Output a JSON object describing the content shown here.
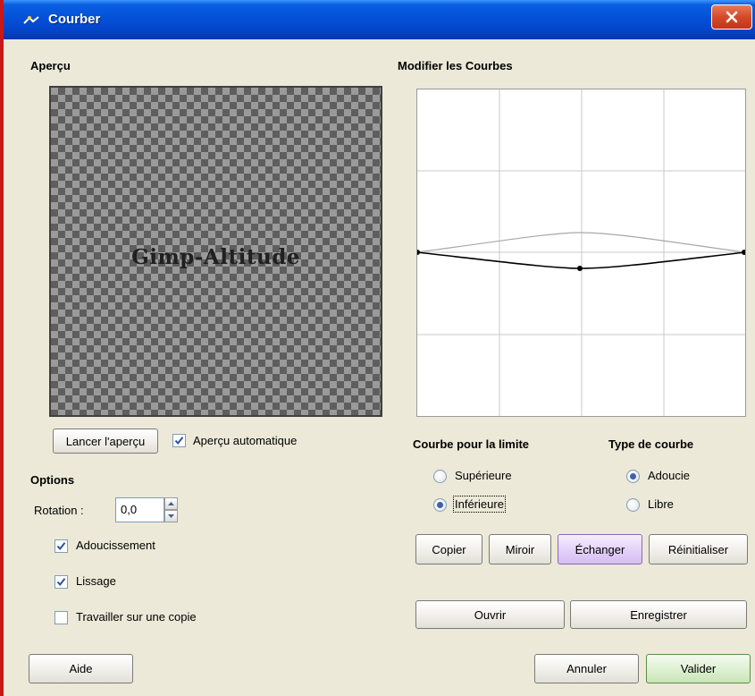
{
  "window": {
    "title": "Courber",
    "icon": "curve-tool-icon",
    "close_icon": "close-icon"
  },
  "preview": {
    "title": "Aperçu",
    "text": "Gimp-Altitude",
    "launch_button": "Lancer l'aperçu",
    "auto_preview_label": "Aperçu automatique",
    "auto_preview_checked": true
  },
  "options": {
    "title": "Options",
    "rotation_label": "Rotation :",
    "rotation_value": "0,0",
    "antialiasing_label": "Adoucissement",
    "antialiasing_checked": true,
    "smoothing_label": "Lissage",
    "smoothing_checked": true,
    "work_on_copy_label": "Travailler sur une copie",
    "work_on_copy_checked": false
  },
  "curves": {
    "title": "Modifier les Courbes",
    "boundary_title": "Courbe pour la limite",
    "boundary_options": [
      {
        "label": "Supérieure",
        "selected": false
      },
      {
        "label": "Inférieure",
        "selected": true
      }
    ],
    "type_title": "Type de courbe",
    "type_options": [
      {
        "label": "Adoucie",
        "selected": true
      },
      {
        "label": "Libre",
        "selected": false
      }
    ]
  },
  "actions": {
    "copy": "Copier",
    "mirror": "Miroir",
    "swap": "Échanger",
    "reset": "Réinitialiser",
    "open": "Ouvrir",
    "save": "Enregistrer"
  },
  "footer": {
    "help": "Aide",
    "cancel": "Annuler",
    "ok": "Valider"
  },
  "colors": {
    "titlebar": "#0451d8",
    "dialog_bg": "#ece9d8",
    "swap_hover": "#d5bdf3",
    "ok_default": "#c8e6b6",
    "radio_dot": "#4060a8",
    "check_mark": "#2a50a0"
  }
}
